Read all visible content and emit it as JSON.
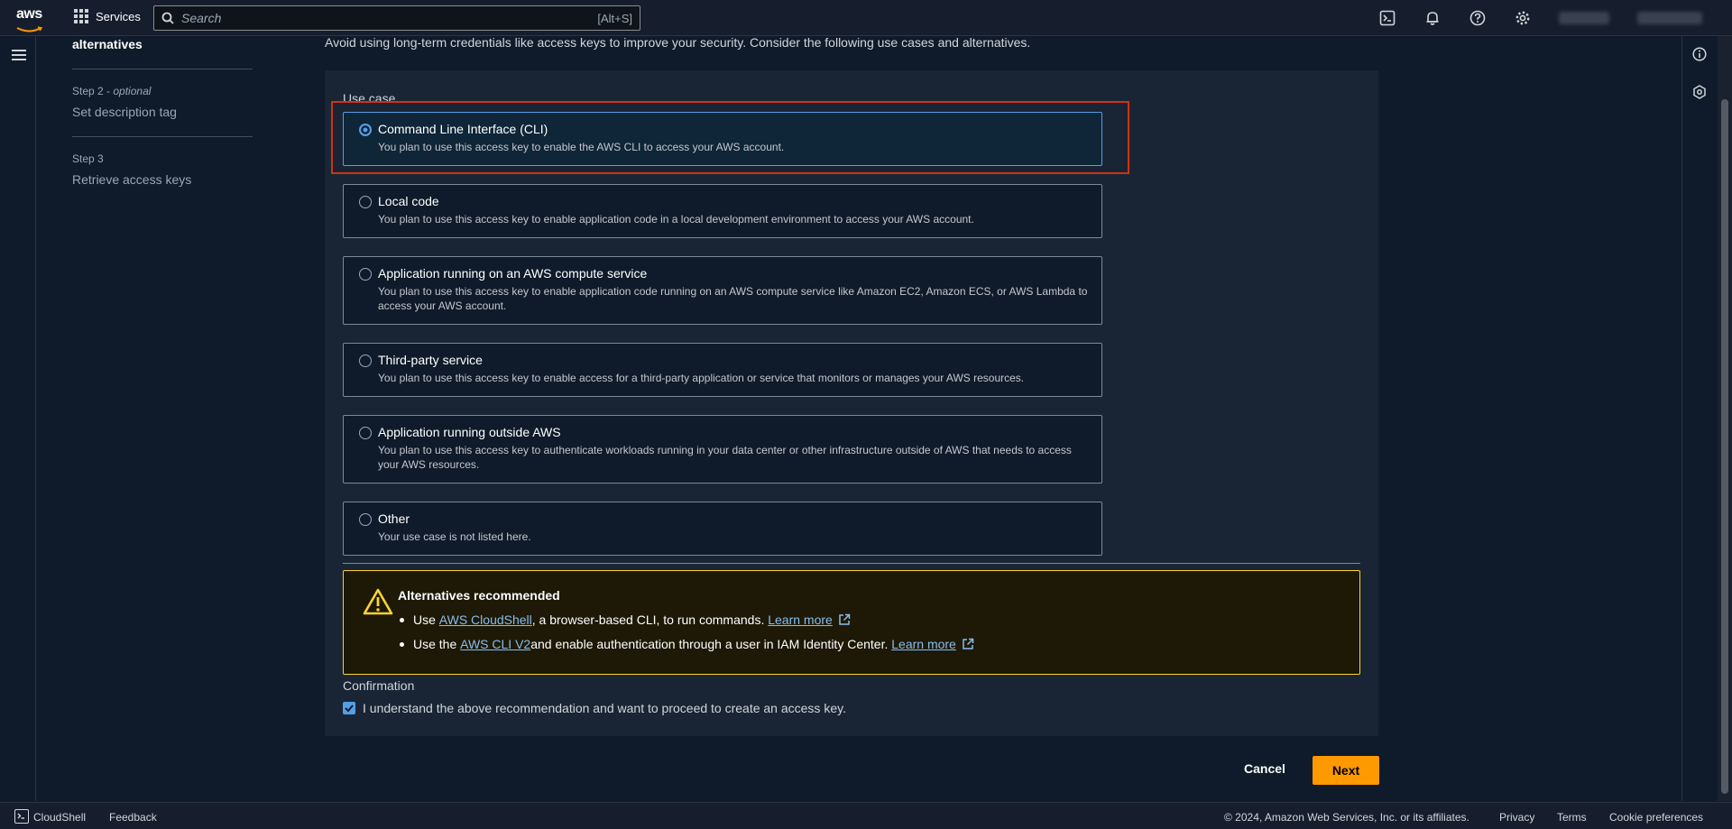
{
  "nav": {
    "logo": "aws",
    "services_label": "Services",
    "search_placeholder": "Search",
    "search_shortcut": "[Alt+S]"
  },
  "steps": {
    "current_title": "alternatives",
    "step2_label": "Step 2",
    "step2_optional": "optional",
    "step2_title": "Set description tag",
    "step3_label": "Step 3",
    "step3_title": "Retrieve access keys"
  },
  "intro": "Avoid using long-term credentials like access keys to improve your security. Consider the following use cases and alternatives.",
  "use_case": {
    "label": "Use case",
    "options": [
      {
        "title": "Command Line Interface (CLI)",
        "desc": "You plan to use this access key to enable the AWS CLI to access your AWS account.",
        "selected": true
      },
      {
        "title": "Local code",
        "desc": "You plan to use this access key to enable application code in a local development environment to access your AWS account.",
        "selected": false
      },
      {
        "title": "Application running on an AWS compute service",
        "desc": "You plan to use this access key to enable application code running on an AWS compute service like Amazon EC2, Amazon ECS, or AWS Lambda to access your AWS account.",
        "selected": false
      },
      {
        "title": "Third-party service",
        "desc": "You plan to use this access key to enable access for a third-party application or service that monitors or manages your AWS resources.",
        "selected": false
      },
      {
        "title": "Application running outside AWS",
        "desc": "You plan to use this access key to authenticate workloads running in your data center or other infrastructure outside of AWS that needs to access your AWS resources.",
        "selected": false
      },
      {
        "title": "Other",
        "desc": "Your use case is not listed here.",
        "selected": false
      }
    ]
  },
  "alert": {
    "title": "Alternatives recommended",
    "item1_prefix": "Use ",
    "item1_link": "AWS CloudShell",
    "item1_suffix": ", a browser-based CLI, to run commands. ",
    "item1_learn": "Learn more",
    "item2_prefix": "Use the ",
    "item2_link": "AWS CLI V2",
    "item2_suffix": " and enable authentication through a user in IAM Identity Center. ",
    "item2_learn": "Learn more"
  },
  "confirmation": {
    "label": "Confirmation",
    "checkbox_text": "I understand the above recommendation and want to proceed to create an access key.",
    "checked": true
  },
  "actions": {
    "cancel": "Cancel",
    "next": "Next"
  },
  "footer": {
    "cloudshell": "CloudShell",
    "feedback": "Feedback",
    "copyright": "© 2024, Amazon Web Services, Inc. or its affiliates.",
    "privacy": "Privacy",
    "terms": "Terms",
    "cookies": "Cookie preferences"
  },
  "colors": {
    "accent": "#539fe5",
    "primary_button": "#ff9900",
    "warning_border": "#fbd332",
    "highlight": "#d13212"
  }
}
